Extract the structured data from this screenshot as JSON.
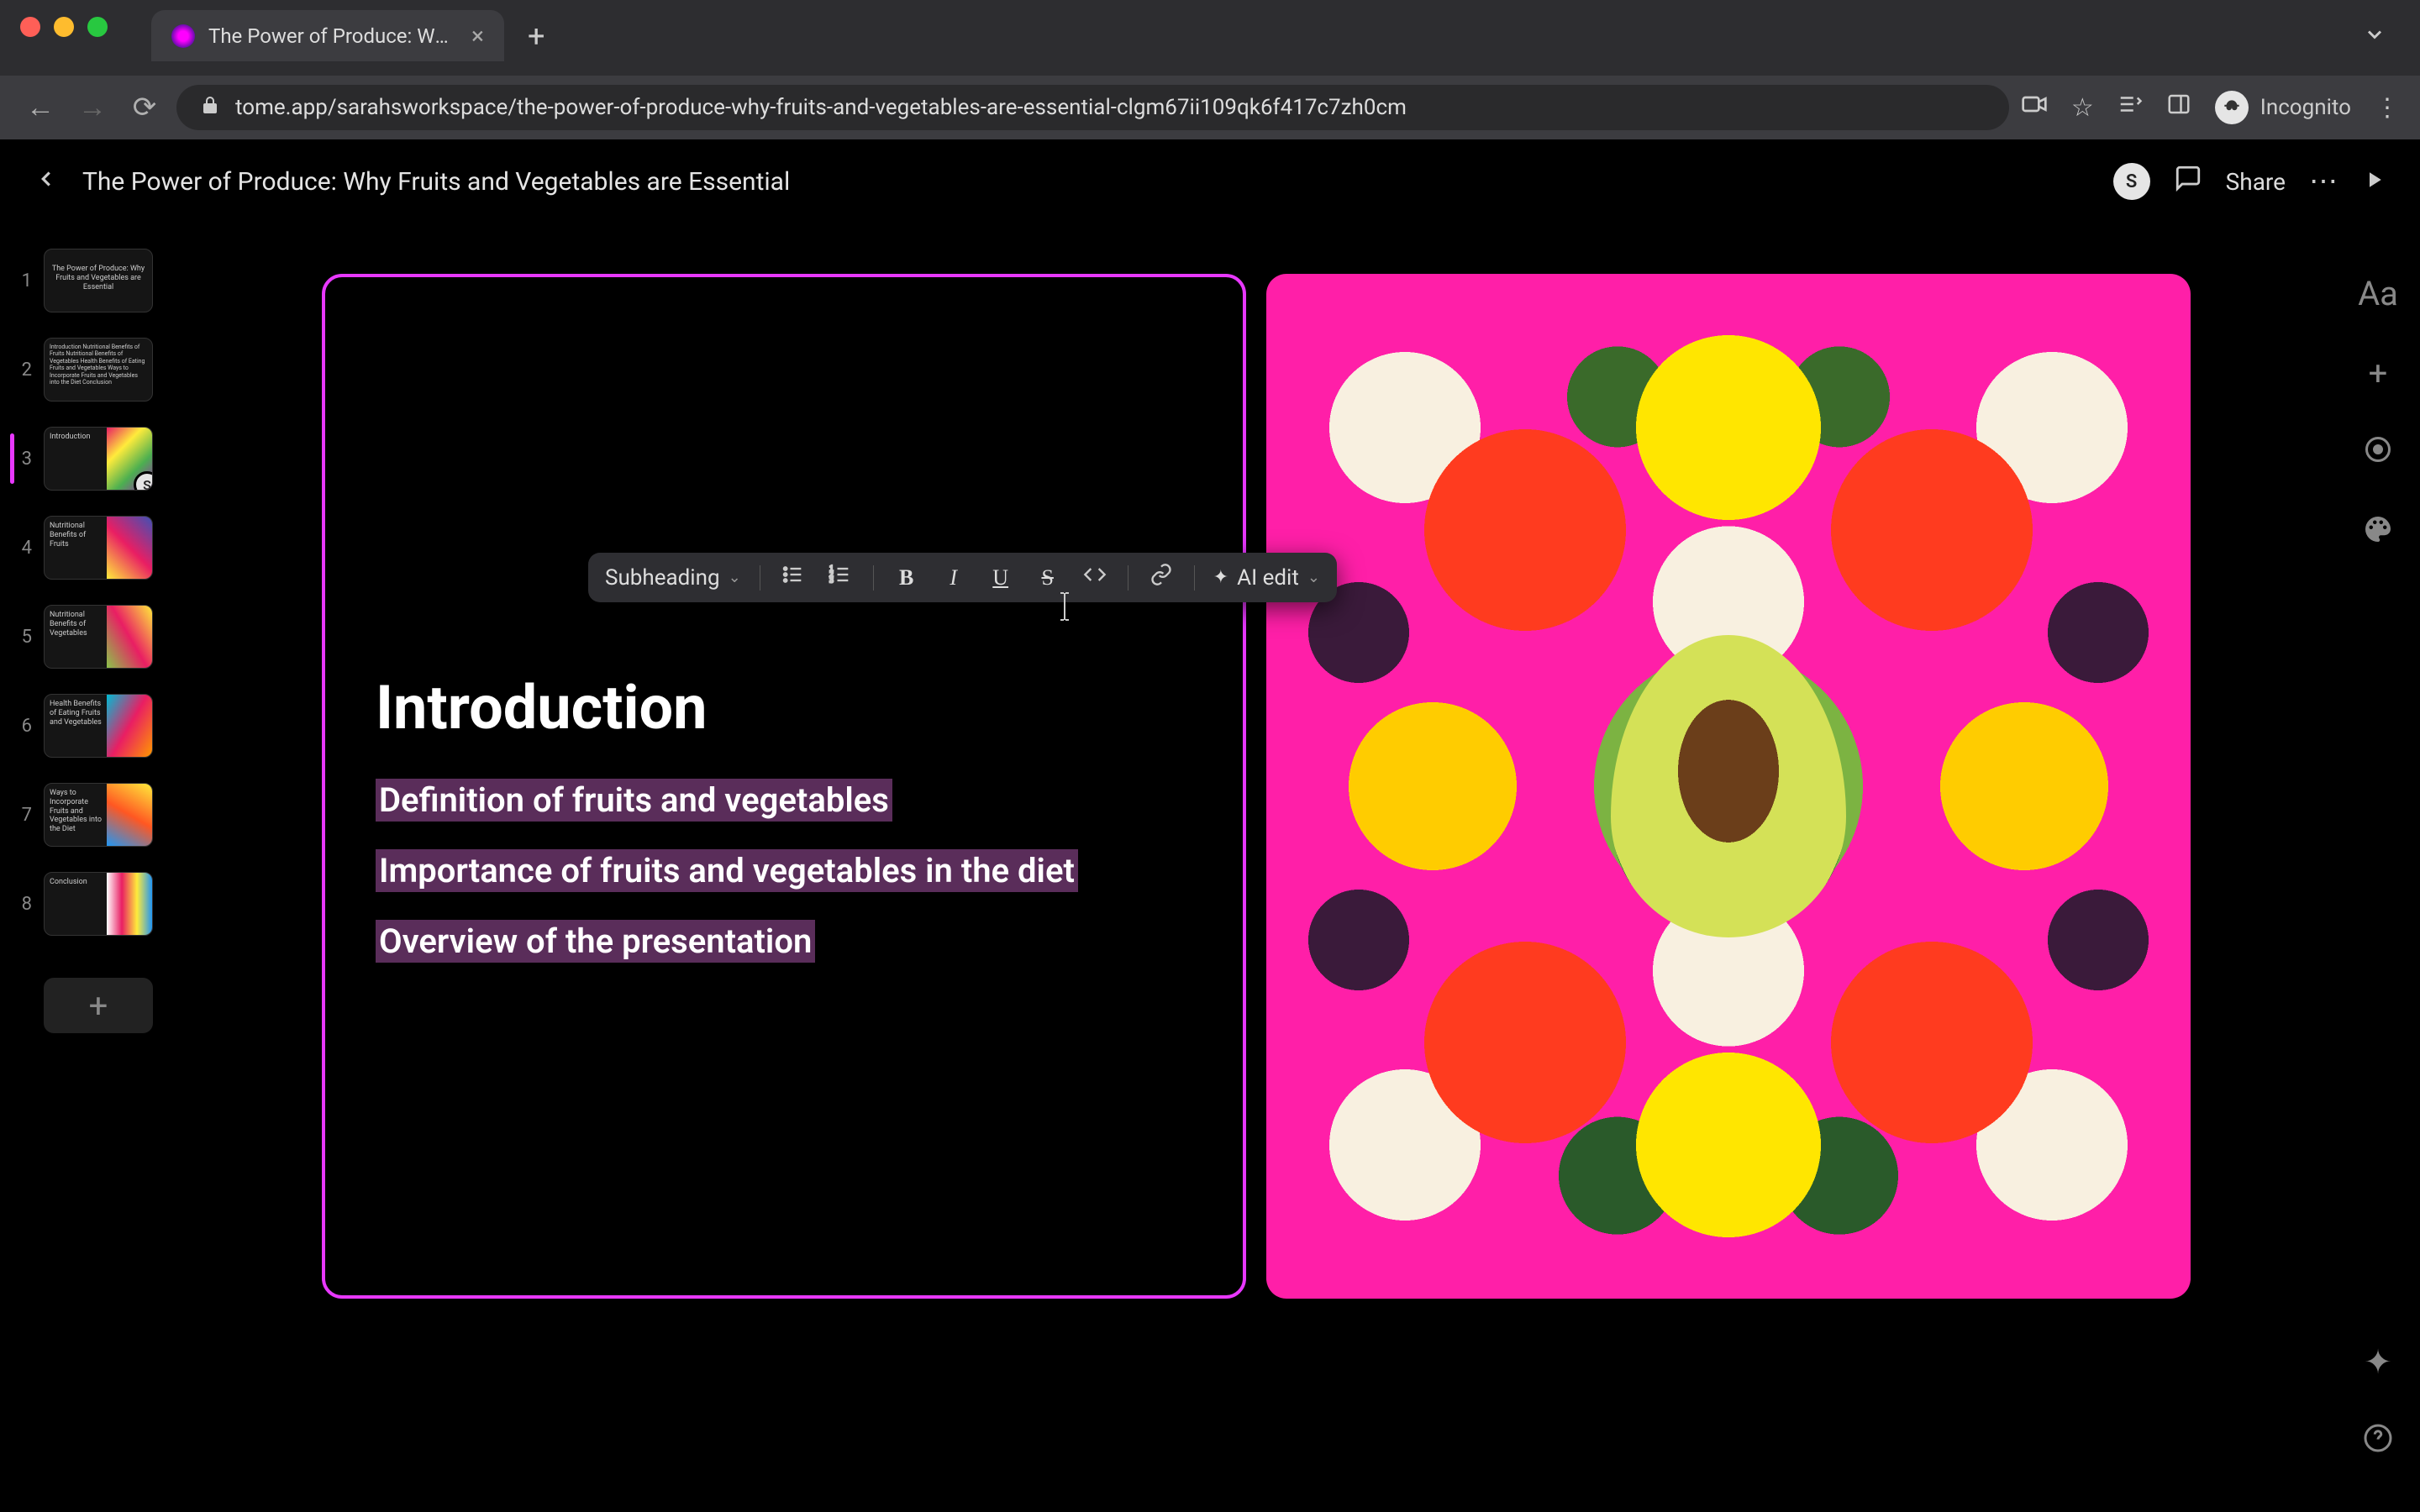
{
  "browser": {
    "tab_title": "The Power of Produce: Why Fr",
    "url": "tome.app/sarahsworkspace/the-power-of-produce-why-fruits-and-vegetables-are-essential-clgm67ii109qk6f417c7zh0cm",
    "incognito_label": "Incognito"
  },
  "header": {
    "doc_title": "The Power of Produce: Why Fruits and Vegetables are Essential",
    "share_label": "Share",
    "avatar_initial": "S"
  },
  "sidebar": {
    "slides": [
      {
        "num": "1",
        "text": "The Power of Produce: Why Fruits and Vegetables are Essential"
      },
      {
        "num": "2",
        "text": "Introduction\nNutritional Benefits of Fruits\nNutritional Benefits of Vegetables\nHealth Benefits of Eating Fruits and Vegetables\nWays to Incorporate Fruits and Vegetables into the Diet\nConclusion"
      },
      {
        "num": "3",
        "text": "Introduction"
      },
      {
        "num": "4",
        "text": "Nutritional Benefits of Fruits"
      },
      {
        "num": "5",
        "text": "Nutritional Benefits of Vegetables"
      },
      {
        "num": "6",
        "text": "Health Benefits of Eating Fruits and Vegetables"
      },
      {
        "num": "7",
        "text": "Ways to Incorporate Fruits and Vegetables into the Diet"
      },
      {
        "num": "8",
        "text": "Conclusion"
      }
    ],
    "active_index": 2,
    "active_avatar": "S"
  },
  "slide": {
    "heading": "Introduction",
    "lines": [
      "Definition of fruits and vegetables",
      "Importance of fruits and vegetables in the diet",
      "Overview of the presentation"
    ]
  },
  "toolbar": {
    "style_label": "Subheading",
    "ai_label": "AI edit"
  },
  "colors": {
    "selection_border": "#e838ff",
    "highlight_bg": "#5a2d5a"
  }
}
